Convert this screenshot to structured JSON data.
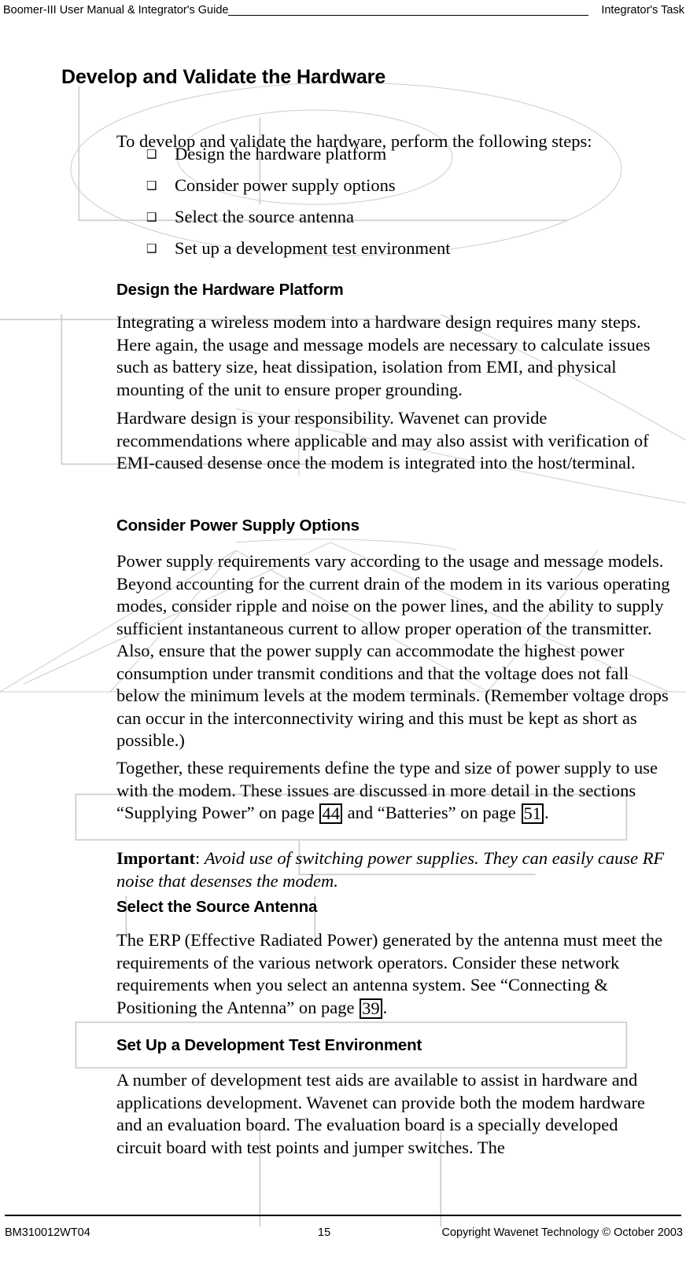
{
  "header": {
    "left_text": "Boomer-III User Manual & Integrator's Guide",
    "right_text": "Integrator's Task"
  },
  "document": {
    "section_title": "Develop and Validate the Hardware",
    "lead_paragraph": "To develop and validate the hardware, perform the following steps:",
    "bullet_glyph": "❑",
    "steps": [
      {
        "label": "Design the hardware platform"
      },
      {
        "label": "Consider power supply options"
      },
      {
        "label": "Select the source antenna"
      },
      {
        "label": "Set up a development test environment"
      }
    ],
    "subsections": [
      {
        "heading": "Design the Hardware Platform",
        "paragraphs": [
          "Integrating a wireless modem into a hardware design requires many steps. Here again, the usage and message models are necessary to calculate issues such as battery size, heat dissipation, isolation from EMI, and physical mounting of the unit to ensure proper grounding.",
          "Hardware design is your responsibility. Wavenet can provide recommendations where applicable and may also assist with verification of EMI-caused desense once the modem is integrated into the host/terminal."
        ]
      },
      {
        "heading": "Consider Power Supply Options",
        "paragraphs": [
          "Power supply requirements vary according to the usage and message models. Beyond accounting for the current drain of the modem in its various operating modes, consider ripple and noise on the power lines, and the ability to supply sufficient instantaneous current to allow proper operation of the transmitter. Also, ensure that the power supply can accommodate the highest power consumption under transmit conditions and that the voltage does not fall below the minimum levels at the modem terminals. (Remember voltage drops can occur in the interconnectivity wiring and this must be kept as short as possible.)"
        ],
        "xref_paragraph": {
          "part_1": "Together, these requirements define the type and size of power supply to use with the modem. These issues are discussed in more detail in the sections “Supplying Power” on page ",
          "xref_1": "44",
          "part_2": " and “Batteries” on page ",
          "xref_2": "51",
          "part_3": "."
        },
        "important": {
          "label": "Important",
          "separator": ": ",
          "text": "Avoid use of switching power supplies. They can easily cause RF noise that desenses the modem."
        }
      },
      {
        "heading": "Select the Source Antenna",
        "xref_paragraph": {
          "part_1": "The ERP (Effective Radiated Power) generated by the antenna must meet the requirements of the various network operators. Consider these network requirements when you select an antenna system. See “Connecting & Positioning the Antenna” on page ",
          "xref_1": "39",
          "part_2": "."
        }
      },
      {
        "heading": "Set Up a Development Test Environment",
        "paragraphs": [
          "A number of development test aids are available to assist in hardware and applications development. Wavenet can provide both the modem hardware and an evaluation board. The evaluation board is a specially developed circuit board with test points and jumper switches. The"
        ]
      }
    ]
  },
  "footer": {
    "doc_number": "BM310012WT04",
    "page_number": "15",
    "copyright": "Copyright Wavenet Technology © October 2003"
  },
  "colors": {
    "text": "#000000",
    "background": "#ffffff",
    "artifact_line": "#c8c8c8"
  }
}
